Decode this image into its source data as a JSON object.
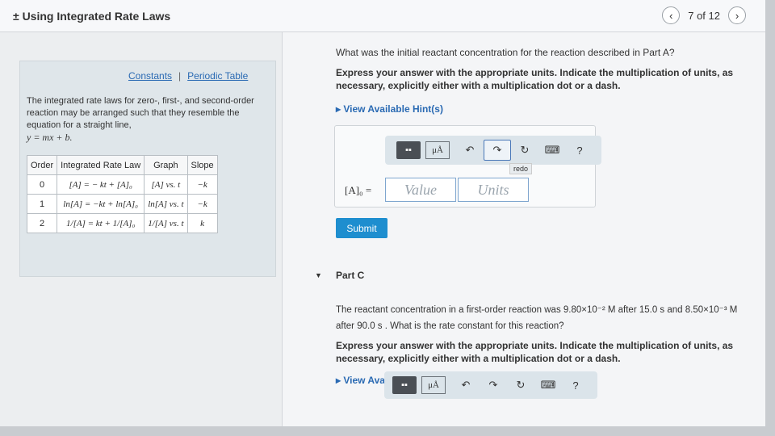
{
  "header": {
    "title": "± Using Integrated Rate Laws",
    "page_counter": "7 of 12",
    "prev_icon": "‹",
    "next_icon": "›"
  },
  "sidebar": {
    "constants_link": "Constants",
    "separator": "|",
    "periodic_link": "Periodic Table",
    "description": "The integrated rate laws for zero-, first-, and second-order reaction may be arranged such that they resemble the equation for a straight line,",
    "equation": "y = mx + b.",
    "table": {
      "headers": [
        "Order",
        "Integrated Rate Law",
        "Graph",
        "Slope"
      ],
      "rows": [
        [
          "0",
          "[A] = − kt + [A]₀",
          "[A] vs. t",
          "−k"
        ],
        [
          "1",
          "ln[A] = −kt + ln[A]₀",
          "ln[A] vs. t",
          "−k"
        ],
        [
          "2",
          "1/[A] = kt + 1/[A]₀",
          "1/[A] vs. t",
          "k"
        ]
      ]
    }
  },
  "partB": {
    "question": "What was the initial reactant concentration for the reaction described in Part A?",
    "instruction": "Express your answer with the appropriate units. Indicate the multiplication of units, as necessary, explicitly either with a multiplication dot or a dash.",
    "hint_link": "▸ View Available Hint(s)",
    "answer_label": "[A]₀ =",
    "value_placeholder": "Value",
    "units_placeholder": "Units",
    "redo_tooltip": "redo",
    "submit": "Submit",
    "toolbar": {
      "templates": "▪▪",
      "mu": "μÅ",
      "undo": "↶",
      "redo": "↷",
      "reset": "↻",
      "keyboard": "⌨",
      "help": "?"
    }
  },
  "partC": {
    "label": "Part C",
    "caret": "▼",
    "text_1": "The reactant concentration in a first-order reaction was 9.80×10⁻² M after 15.0 s and 8.50×10⁻³ M after 90.0 s . What is the rate constant for this reaction?",
    "instruction": "Express your answer with the appropriate units. Indicate the multiplication of units, as necessary, explicitly either with a multiplication dot or a dash.",
    "hint_link": "▸ View Available Hint(s)"
  }
}
